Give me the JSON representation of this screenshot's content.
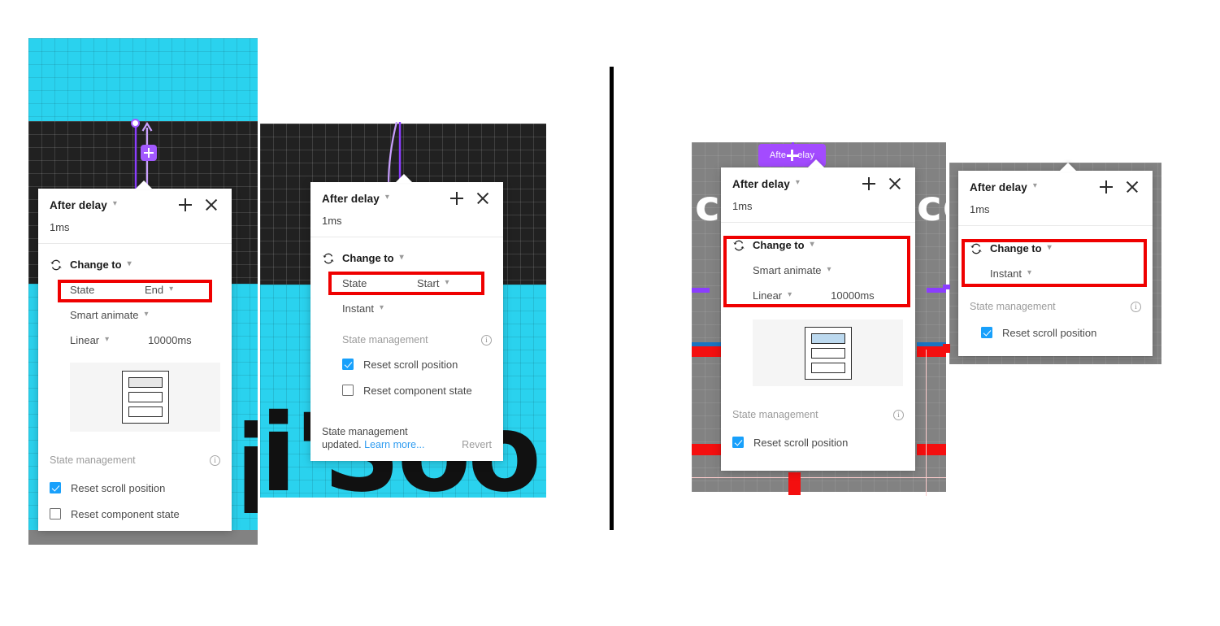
{
  "common": {
    "title": "After delay",
    "delay_value": "1ms",
    "change_to": "Change to",
    "state_key": "State",
    "smart_animate": "Smart animate",
    "instant": "Instant",
    "linear": "Linear",
    "duration": "10000ms",
    "state_management": "State management",
    "reset_scroll_position": "Reset scroll position",
    "reset_component_state": "Reset component state",
    "plus_icon": "plus-icon",
    "close_icon": "close-icon",
    "chevron_icon": "chevron-down-icon",
    "change_icon": "change-to-icon",
    "info_icon": "info-icon",
    "accent_blue": "#18a0fb",
    "highlight_red": "#ef0000",
    "purple": "#a34bff"
  },
  "panels": [
    {
      "id": "panel-1",
      "title": "After delay",
      "delay_value": "1ms",
      "change_to": "Change to",
      "state_key": "State",
      "state_value": "End",
      "animation": "Smart animate",
      "easing": "Linear",
      "duration": "10000ms",
      "state_management": "State management",
      "checks": [
        {
          "label": "Reset scroll position",
          "checked": true
        },
        {
          "label": "Reset component state",
          "checked": false
        }
      ],
      "has_thumb": true,
      "thumb_highlight": "gray",
      "toast": null
    },
    {
      "id": "panel-2",
      "title": "After delay",
      "delay_value": "1ms",
      "change_to": "Change to",
      "state_key": "State",
      "state_value": "Start",
      "animation": "Instant",
      "easing": null,
      "duration": null,
      "state_management": "State management",
      "checks": [
        {
          "label": "Reset scroll position",
          "checked": true
        },
        {
          "label": "Reset component state",
          "checked": false
        }
      ],
      "has_thumb": false,
      "toast": {
        "line1": "State management",
        "line2_prefix": "updated. ",
        "link": "Learn more...",
        "revert": "Revert"
      }
    },
    {
      "id": "panel-3",
      "title": "After delay",
      "delay_value": "1ms",
      "change_to": "Change to",
      "state_key": null,
      "state_value": null,
      "animation": "Smart animate",
      "easing": "Linear",
      "duration": "10000ms",
      "state_management": "State management",
      "checks": [
        {
          "label": "Reset scroll position",
          "checked": true
        }
      ],
      "has_thumb": true,
      "thumb_highlight": "blue",
      "toast": null
    },
    {
      "id": "panel-4",
      "title": "After delay",
      "delay_value": "1ms",
      "change_to": "Change to",
      "state_key": null,
      "state_value": null,
      "animation": "Instant",
      "easing": null,
      "duration": null,
      "state_management": "State management",
      "checks": [
        {
          "label": "Reset scroll position",
          "checked": true
        }
      ],
      "has_thumb": false,
      "toast": null
    }
  ],
  "canvas": {
    "badge_label_left": "Afte",
    "badge_label_right": "elay",
    "big_text_2": "i'Soolifv",
    "big_text_3_left": "co",
    "big_text_3_right": "co",
    "cyan": "#2ad2ee",
    "dark": "#212121",
    "gray": "#828282",
    "red": "#f40f0f",
    "blue": "#1a74c0",
    "purple_bar": "#8b3dff"
  }
}
